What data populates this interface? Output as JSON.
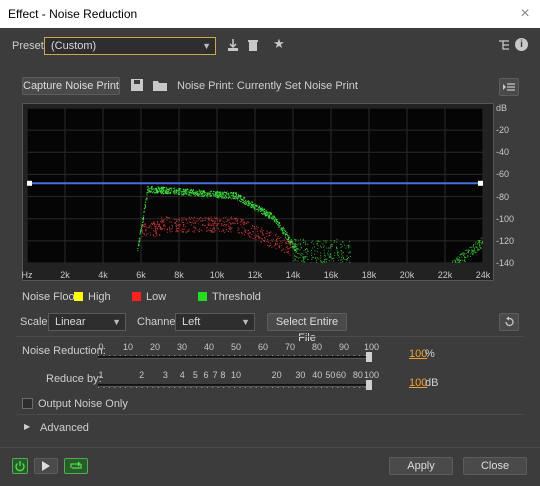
{
  "window": {
    "title": "Effect - Noise Reduction",
    "close_glyph": "×"
  },
  "presets": {
    "label": "Presets:",
    "value": "(Custom)"
  },
  "toolbar": {
    "capture_label": "Capture Noise Print",
    "noise_print_status": "Noise Print: Currently Set Noise Print"
  },
  "graph": {
    "x_ticks": [
      "Hz",
      "2k",
      "4k",
      "6k",
      "8k",
      "10k",
      "12k",
      "14k",
      "16k",
      "18k",
      "20k",
      "22k",
      "24k"
    ],
    "y_ticks": [
      "dB",
      "-20",
      "-40",
      "-60",
      "-80",
      "-100",
      "-120",
      "-140"
    ],
    "threshold_db": -68
  },
  "legend": {
    "label": "Noise Floor:",
    "items": [
      {
        "label": "High",
        "color": "#ffff00"
      },
      {
        "label": "Low",
        "color": "#ff2020"
      },
      {
        "label": "Threshold",
        "color": "#22dd22"
      }
    ]
  },
  "controls": {
    "scale_label": "Scale:",
    "scale_value": "Linear",
    "channel_label": "Channel:",
    "channel_value": "Left",
    "select_file_label": "Select Entire File"
  },
  "noise_reduction": {
    "label": "Noise Reduction:",
    "scale": [
      "0",
      "10",
      "20",
      "30",
      "40",
      "50",
      "60",
      "70",
      "80",
      "90",
      "100"
    ],
    "value": "100",
    "unit": "%"
  },
  "reduce_by": {
    "label": "Reduce by:",
    "scale": [
      "1",
      "2",
      "3",
      "4",
      "5",
      "6",
      "7",
      "8",
      "10",
      "20",
      "30",
      "40",
      "50",
      "60",
      "80",
      "100"
    ],
    "value": "100",
    "unit": "dB"
  },
  "options": {
    "output_noise_only": "Output Noise Only",
    "advanced": "Advanced"
  },
  "footer": {
    "apply_label": "Apply",
    "close_label": "Close"
  },
  "colors": {
    "accent": "#f0a030",
    "threshold_line": "#4a6de0"
  }
}
